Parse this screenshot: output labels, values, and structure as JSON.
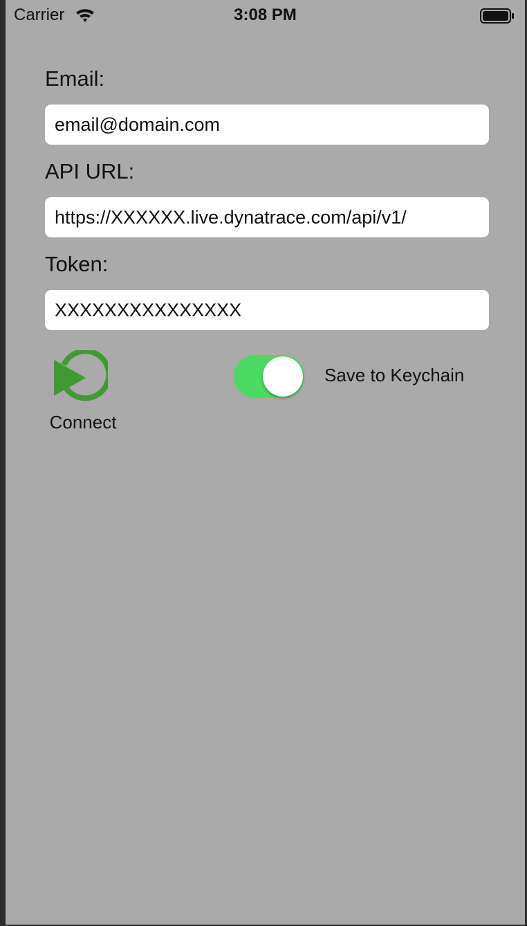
{
  "status_bar": {
    "carrier": "Carrier",
    "time": "3:08 PM",
    "wifi_icon": "wifi-icon",
    "battery_icon": "battery-icon"
  },
  "form": {
    "email": {
      "label": "Email:",
      "value": "email@domain.com"
    },
    "api_url": {
      "label": "API URL:",
      "value": "https://XXXXXX.live.dynatrace.com/api/v1/"
    },
    "token": {
      "label": "Token:",
      "value": "XXXXXXXXXXXXXXX"
    }
  },
  "actions": {
    "connect_label": "Connect",
    "connect_icon": "play-circle-icon",
    "save_to_keychain_label": "Save to Keychain",
    "save_to_keychain_on": true
  },
  "colors": {
    "background": "#aaaaaa",
    "field_background": "#ffffff",
    "toggle_on": "#4cd964",
    "connect_icon": "#3f9b31"
  }
}
